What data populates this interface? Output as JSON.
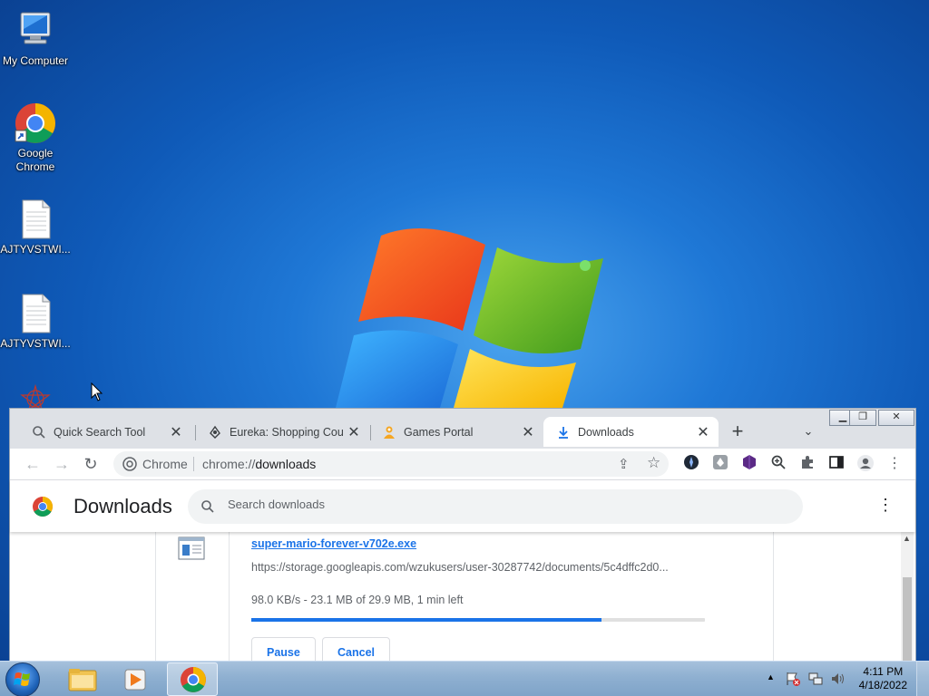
{
  "desktop": {
    "icons": [
      {
        "label": "My Computer"
      },
      {
        "label": "Google Chrome"
      },
      {
        "label": "AJTYVSTWI..."
      },
      {
        "label": "AJTYVSTWI..."
      }
    ]
  },
  "chrome": {
    "tabs": [
      {
        "title": "Quick Search Tool",
        "favicon": "search-icon"
      },
      {
        "title": "Eureka: Shopping Coupons",
        "favicon": "eureka-icon"
      },
      {
        "title": "Games Portal",
        "favicon": "games-icon"
      },
      {
        "title": "Downloads",
        "favicon": "download-icon",
        "active": true
      }
    ],
    "new_tab_label": "+",
    "omnibox": {
      "site_label": "Chrome",
      "url_prefix": "chrome://",
      "url_path": "downloads"
    },
    "extensions": [
      "extension-globe-icon",
      "extension-eureka-icon",
      "extension-gem-icon",
      "zoom-icon",
      "puzzle-icon",
      "sidepanel-icon",
      "profile-icon",
      "menu-icon"
    ]
  },
  "downloads_page": {
    "title": "Downloads",
    "search_placeholder": "Search downloads",
    "item": {
      "filename": "super-mario-forever-v702e.exe",
      "url": "https://storage.googleapis.com/wzukusers/user-30287742/documents/5c4dffc2d0...",
      "status": "98.0 KB/s - 23.1 MB of 29.9 MB, 1 min left",
      "progress_fraction": 0.7726,
      "pause_label": "Pause",
      "cancel_label": "Cancel"
    }
  },
  "taskbar": {
    "pinned": [
      "explorer-icon",
      "media-player-icon",
      "chrome-icon"
    ],
    "clock_time": "4:11 PM",
    "clock_date": "4/18/2022",
    "colors": {
      "accent": "#1a73e8"
    }
  }
}
